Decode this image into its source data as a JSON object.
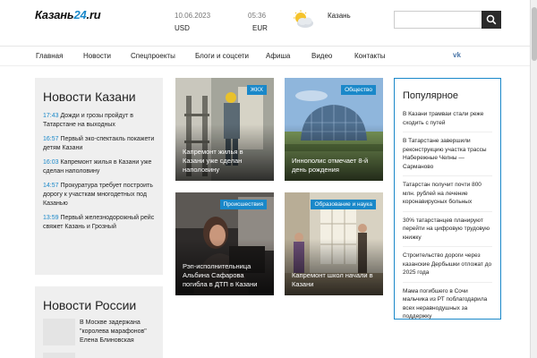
{
  "header": {
    "logo_text": "Казань",
    "logo_num": "24",
    "logo_tld": ".ru",
    "date": "10.06.2023",
    "time": "05:36",
    "currency_1": "USD",
    "currency_2": "EUR",
    "city": "Казань",
    "weather_icon": "cloud-sun-icon",
    "search_placeholder": "",
    "search_icon": "search-icon"
  },
  "nav": {
    "items": [
      "Главная",
      "Новости",
      "Спецпроекты",
      "Блоги и соцсети",
      "Афиша",
      "Видео",
      "Контакты"
    ],
    "social_icon": "vk-icon",
    "social_label": "vk"
  },
  "kazan_news": {
    "title": "Новости Казани",
    "items": [
      {
        "time": "17:43",
        "text": "Дожди и грозы пройдут в Татарстане на выходных"
      },
      {
        "time": "16:57",
        "text": "Первый эко-спектакль покажети детям Казани"
      },
      {
        "time": "16:03",
        "text": "Капремонт жилья в Казани уже сделан наполовину"
      },
      {
        "time": "14:57",
        "text": "Прокуратура требует построить дорогу к участкам многодетных под Казанью"
      },
      {
        "time": "13:59",
        "text": "Первый железнодорожный рейс свяжет Казань и Грозный"
      }
    ]
  },
  "russia_news": {
    "title": "Новости России",
    "items": [
      {
        "text": "В Москве задержана \"королева марафонов\" Елена Блиновская"
      }
    ]
  },
  "cards": [
    {
      "tag": "ЖКХ",
      "title": "Капремонт жилья в Казани уже сделан наполовину"
    },
    {
      "tag": "Общество",
      "title": "Иннополис отмечает 8-й день рождения"
    },
    {
      "tag": "Происшествия",
      "title": "Рэп-исполнительница Альбина Сафарова погибла в ДТП в Казани"
    },
    {
      "tag": "Образование и наука",
      "title": "Капремонт школ начали в Казани"
    }
  ],
  "popular": {
    "title": "Популярное",
    "items": [
      "В Казани трамваи стали реже сходить с путей",
      "В Татарстане завершили реконструкцию участка трассы Набережные Челны — Сарманово",
      "Татарстан получит почти 800 млн. рублей на лечение коронавирусных больных",
      "30% татарстанцев планируют перейти на цифровую трудовую книжку",
      "Строительство дороги через казанские Дербышки отложат до 2025 года",
      "Мама погибшего в Сочи мальчика из РТ поблагодарила всех неравнодушных за поддержку"
    ]
  },
  "colors": {
    "accent": "#1a88c9",
    "tag_bg": "#1a88c9",
    "box_bg": "#efefef",
    "search_btn": "#2b2b2b"
  }
}
